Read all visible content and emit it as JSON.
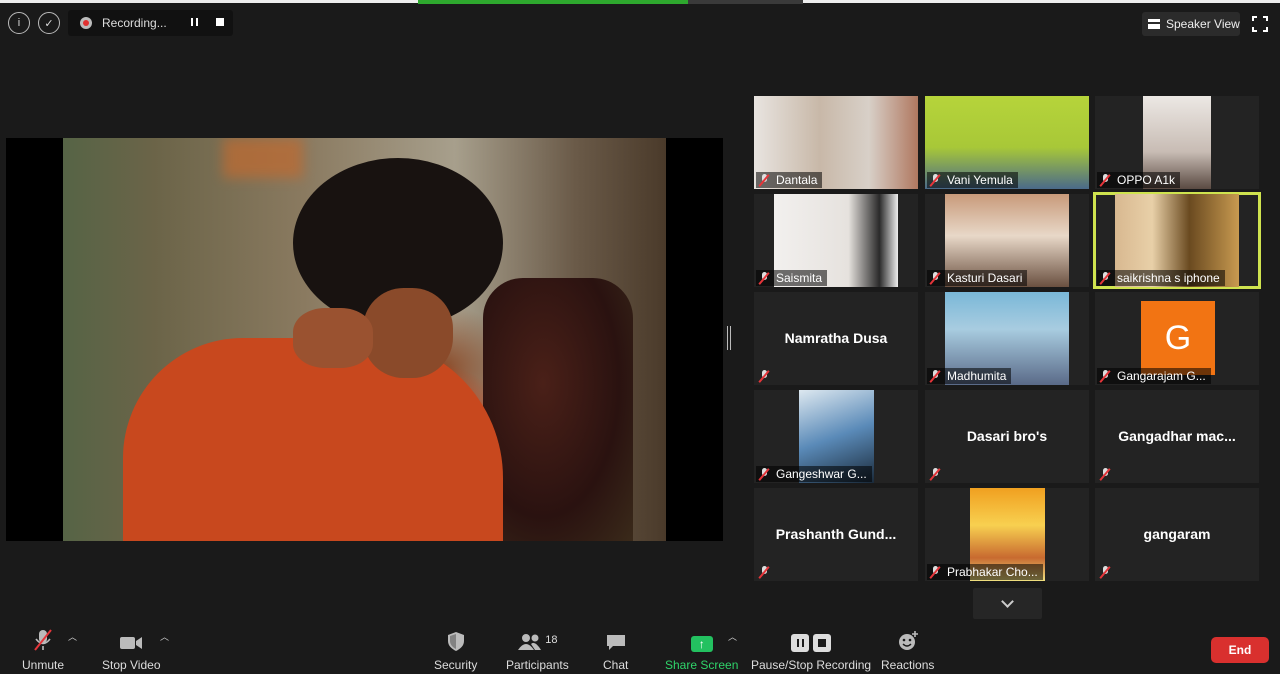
{
  "top": {
    "recording_text": "Recording...",
    "speaker_view_label": "Speaker View",
    "share_progress": 0.7
  },
  "gallery": {
    "tiles": [
      {
        "name": "Dantala",
        "video": true
      },
      {
        "name": "Vani Yemula",
        "video": true
      },
      {
        "name": "OPPO A1k",
        "video": true
      },
      {
        "name": "Saismita",
        "video": true
      },
      {
        "name": "Kasturi Dasari",
        "video": true
      },
      {
        "name": "saikrishna s iphone",
        "video": true,
        "active": true
      },
      {
        "name": "Namratha Dusa",
        "video": false
      },
      {
        "name": "Madhumita",
        "video": true
      },
      {
        "name": "Gangarajam G...",
        "video": false,
        "avatar_letter": "G"
      },
      {
        "name": "Gangeshwar G...",
        "video": true
      },
      {
        "name": "Dasari bro's",
        "video": false
      },
      {
        "name": "Gangadhar  mac...",
        "video": false
      },
      {
        "name": "Prashanth  Gund...",
        "video": false
      },
      {
        "name": "Prabhakar Cho...",
        "video": true
      },
      {
        "name": "gangaram",
        "video": false
      }
    ]
  },
  "toolbar": {
    "unmute": "Unmute",
    "stop_video": "Stop Video",
    "security": "Security",
    "participants": "Participants",
    "participant_count": "18",
    "chat": "Chat",
    "share_screen": "Share Screen",
    "pause_stop_recording": "Pause/Stop Recording",
    "reactions": "Reactions",
    "end": "End"
  },
  "colors": {
    "accent_green": "#23c160",
    "end_red": "#d9302e",
    "active_speaker": "#cfe34f",
    "avatar_orange": "#f27413"
  }
}
